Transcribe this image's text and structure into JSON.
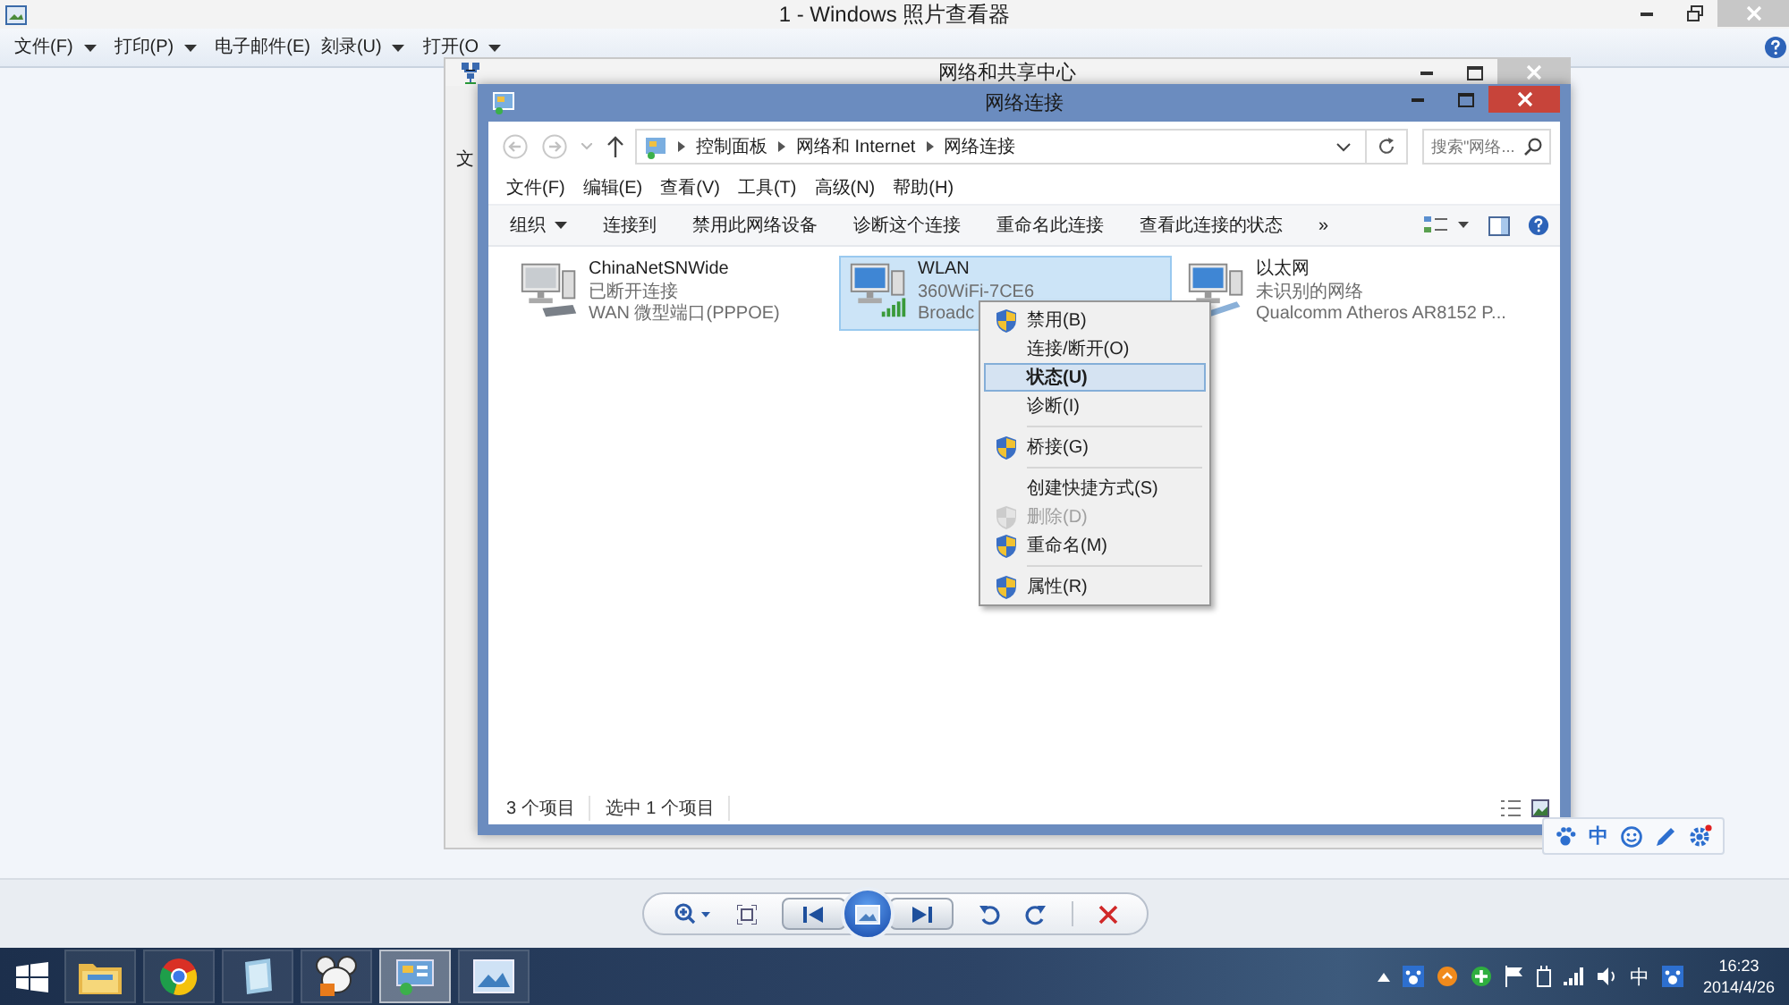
{
  "viewer": {
    "title": "1 - Windows 照片查看器",
    "menu": [
      {
        "label": "文件(F)",
        "dropdown": true
      },
      {
        "label": "打印(P)",
        "dropdown": true
      },
      {
        "label": "电子邮件(E)",
        "dropdown": false
      },
      {
        "label": "刻录(U)",
        "dropdown": true
      },
      {
        "label": "打开(O",
        "dropdown": true
      }
    ]
  },
  "sharing_center": {
    "title": "网络和共享中心",
    "menu_fragment": "文"
  },
  "connections": {
    "title": "网络连接",
    "breadcrumb": [
      "控制面板",
      "网络和 Internet",
      "网络连接"
    ],
    "search": {
      "placeholder": "搜索\"网络..."
    },
    "menu": [
      "文件(F)",
      "编辑(E)",
      "查看(V)",
      "工具(T)",
      "高级(N)",
      "帮助(H)"
    ],
    "toolbar": [
      {
        "label": "组织",
        "dropdown": true
      },
      {
        "label": "连接到",
        "dropdown": false
      },
      {
        "label": "禁用此网络设备",
        "dropdown": false
      },
      {
        "label": "诊断这个连接",
        "dropdown": false
      },
      {
        "label": "重命名此连接",
        "dropdown": false
      },
      {
        "label": "查看此连接的状态",
        "dropdown": false
      },
      {
        "label": "»",
        "dropdown": false
      }
    ],
    "adapters": [
      {
        "kind": "dialup",
        "name": "ChinaNetSNWide",
        "status": "已断开连接",
        "device": "WAN 微型端口(PPPOE)",
        "selected": false
      },
      {
        "kind": "wifi",
        "name": "WLAN",
        "status": "360WiFi-7CE6",
        "device": "Broadc",
        "selected": true
      },
      {
        "kind": "ethernet",
        "name": "以太网",
        "status": "未识别的网络",
        "device": "Qualcomm Atheros AR8152 P...",
        "selected": false
      }
    ],
    "status_bar": [
      "3 个项目",
      "选中 1 个项目"
    ]
  },
  "context_menu": [
    {
      "kind": "item",
      "label": "禁用(B)",
      "shield": true,
      "bold": false,
      "disabled": false,
      "selected": false
    },
    {
      "kind": "item",
      "label": "连接/断开(O)",
      "shield": false,
      "bold": false,
      "disabled": false,
      "selected": false
    },
    {
      "kind": "item",
      "label": "状态(U)",
      "shield": false,
      "bold": true,
      "disabled": false,
      "selected": true
    },
    {
      "kind": "item",
      "label": "诊断(I)",
      "shield": false,
      "bold": false,
      "disabled": false,
      "selected": false
    },
    {
      "kind": "separator"
    },
    {
      "kind": "item",
      "label": "桥接(G)",
      "shield": true,
      "bold": false,
      "disabled": false,
      "selected": false
    },
    {
      "kind": "separator"
    },
    {
      "kind": "item",
      "label": "创建快捷方式(S)",
      "shield": false,
      "bold": false,
      "disabled": false,
      "selected": false
    },
    {
      "kind": "item",
      "label": "删除(D)",
      "shield": true,
      "bold": false,
      "disabled": true,
      "selected": false
    },
    {
      "kind": "item",
      "label": "重命名(M)",
      "shield": true,
      "bold": false,
      "disabled": false,
      "selected": false
    },
    {
      "kind": "separator"
    },
    {
      "kind": "item",
      "label": "属性(R)",
      "shield": true,
      "bold": false,
      "disabled": false,
      "selected": false
    }
  ],
  "ime_bar": {
    "mode": "中"
  },
  "taskbar": {
    "apps": [
      {
        "kind": "folder",
        "selected": false
      },
      {
        "kind": "browser",
        "selected": false
      },
      {
        "kind": "notepad",
        "selected": false
      },
      {
        "kind": "mascot",
        "selected": false
      },
      {
        "kind": "network",
        "selected": true
      },
      {
        "kind": "photos",
        "selected": false
      }
    ],
    "ime": "中",
    "time": "16:23",
    "date": "2014/4/26"
  }
}
